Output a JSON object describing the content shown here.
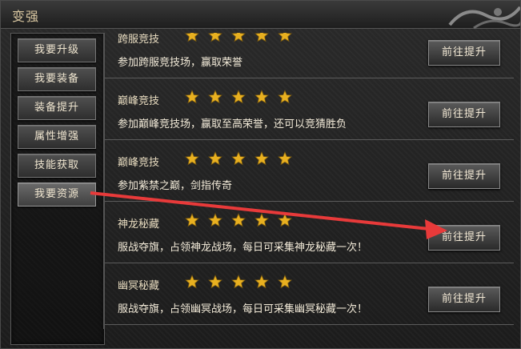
{
  "window": {
    "title": "变强"
  },
  "sidebar": {
    "items": [
      {
        "label": "我要升级",
        "active": false
      },
      {
        "label": "我要装备",
        "active": false
      },
      {
        "label": "装备提升",
        "active": false
      },
      {
        "label": "属性增强",
        "active": false
      },
      {
        "label": "技能获取",
        "active": false
      },
      {
        "label": "我要资源",
        "active": true
      }
    ]
  },
  "rows": [
    {
      "title": "跨服竞技",
      "stars": 5,
      "description": "参加跨服竞技场，赢取荣誉",
      "button": "前往提升"
    },
    {
      "title": "巅峰竞技",
      "stars": 5,
      "description": "参加巅峰竞技场，赢取至高荣誉，还可以竞猜胜负",
      "button": "前往提升"
    },
    {
      "title": "巅峰竞技",
      "stars": 5,
      "description": "参加紫禁之巅，剑指传奇",
      "button": "前往提升"
    },
    {
      "title": "神龙秘藏",
      "stars": 5,
      "description": "服战夺旗，占领神龙战场，每日可采集神龙秘藏一次！",
      "button": "前往提升"
    },
    {
      "title": "幽冥秘藏",
      "stars": 5,
      "description": "服战夺旗，占领幽冥战场，每日可采集幽冥秘藏一次！",
      "button": "前往提升"
    }
  ],
  "colors": {
    "star": "#e8b020",
    "arrow": "#e83a3a",
    "title_text": "#d8c6a0"
  },
  "icons": {
    "star": "star-icon",
    "ornament": "dragon-ornament-icon"
  }
}
